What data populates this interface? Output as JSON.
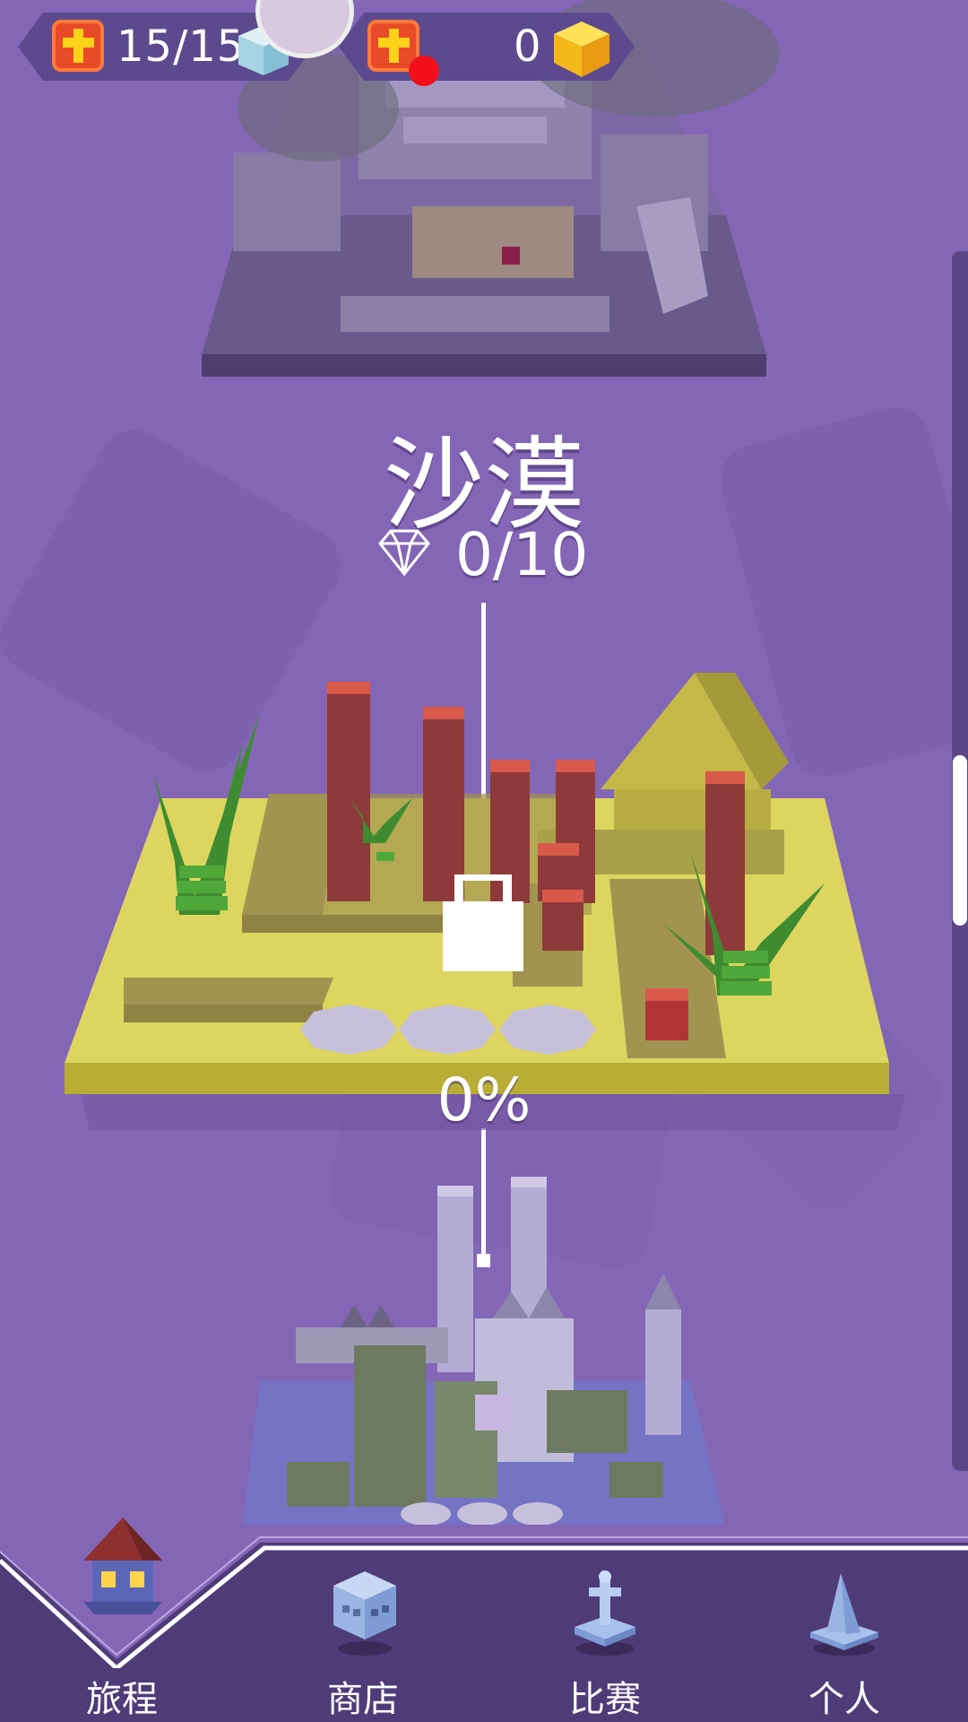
{
  "hud": {
    "lives": "15/15",
    "coins": "0"
  },
  "level": {
    "title": "沙漠",
    "gems": "0/10",
    "progress": "0%",
    "progress_value": 0,
    "locked": true
  },
  "nav": {
    "items": [
      {
        "label": "旅程",
        "icon": "house-icon",
        "active": true
      },
      {
        "label": "商店",
        "icon": "skull-cube-icon",
        "active": false
      },
      {
        "label": "比赛",
        "icon": "trophy-cross-icon",
        "active": false
      },
      {
        "label": "个人",
        "icon": "wizard-hat-icon",
        "active": false
      }
    ]
  },
  "colors": {
    "background": "#8466b7",
    "nav_bar": "#4f3b78",
    "desert_floor": "#d9d05a",
    "pillar_red": "#8e3a3a",
    "accent_red": "#f20f1a"
  }
}
